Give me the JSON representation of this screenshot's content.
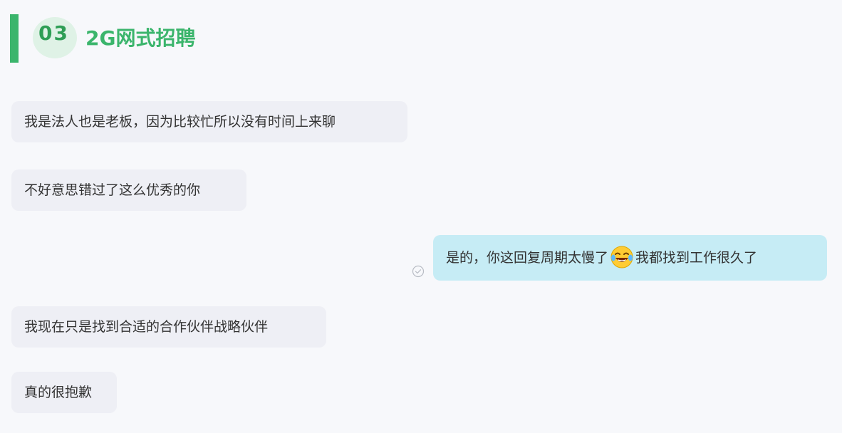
{
  "header": {
    "number": "03",
    "title": "2G网式招聘"
  },
  "messages": [
    {
      "side": "left",
      "text": "我是法人也是老板，因为比较忙所以没有时间上来聊"
    },
    {
      "side": "left",
      "text": "不好意思错过了这么优秀的你"
    },
    {
      "side": "right",
      "text_before": "是的，你这回复周期太慢了",
      "emoji": "laughing-tears-emoji",
      "text_after": "我都找到工作很久了",
      "status_icon": "read-check-icon"
    },
    {
      "side": "left",
      "text": "我现在只是找到合适的合作伙伴战略伙伴"
    },
    {
      "side": "left",
      "text": "真的很抱歉"
    }
  ],
  "colors": {
    "accent": "#3bb56c",
    "left_bubble": "#eeeff5",
    "right_bubble": "#c6ecf5",
    "background": "#f7f8fb"
  }
}
